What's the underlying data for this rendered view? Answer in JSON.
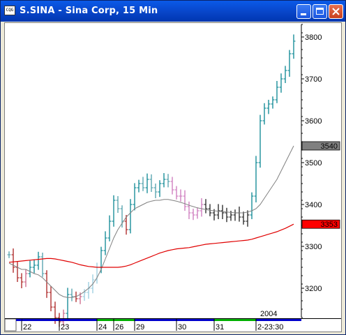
{
  "window": {
    "title": "S.SINA - Sina Corp, 15 Min",
    "icon": "chart-app-icon",
    "icon_text": "CQG",
    "buttons": [
      "minimize-icon",
      "maximize-icon",
      "close-icon"
    ]
  },
  "chart_data": {
    "type": "bar",
    "symbol": "S.SINA",
    "interval": "15 Min",
    "y_ticks": [
      3200,
      3300,
      3400,
      3500,
      3600,
      3700,
      3800
    ],
    "ylim": [
      3130,
      3830
    ],
    "price_markers": [
      {
        "label": "3540",
        "value": 3540,
        "color": "#808080"
      },
      {
        "label": "3353",
        "value": 3353,
        "color": "#ff0000"
      }
    ],
    "x_labels": [
      "22",
      "23",
      "24",
      "26",
      "29",
      "30",
      "31",
      "2-23:30"
    ],
    "x_label_idx": [
      3,
      12,
      21,
      25,
      30,
      40,
      49,
      59
    ],
    "year_label": "2004",
    "timebar_colors": [
      "#0000cc",
      "#0000cc",
      "#00b000",
      "#00b000",
      "#0000cc",
      "#0000cc",
      "#00b000",
      "#0000cc"
    ],
    "closes": [
      3280,
      3250,
      3225,
      3215,
      3235,
      3250,
      3255,
      3275,
      3235,
      3190,
      3155,
      3130,
      3120,
      3140,
      3185,
      3180,
      3175,
      3180,
      3190,
      3200,
      3220,
      3250,
      3290,
      3320,
      3360,
      3410,
      3390,
      3360,
      3340,
      3400,
      3440,
      3450,
      3440,
      3460,
      3440,
      3430,
      3450,
      3460,
      3455,
      3435,
      3420,
      3420,
      3395,
      3380,
      3375,
      3385,
      3400,
      3390,
      3380,
      3375,
      3385,
      3380,
      3370,
      3375,
      3380,
      3370,
      3360,
      3375,
      3420,
      3500,
      3600,
      3630,
      3640,
      3650,
      3680,
      3700,
      3720,
      3760,
      3790
    ],
    "ma_fast": [
      3260,
      3255,
      3250,
      3245,
      3245,
      3240,
      3235,
      3232,
      3225,
      3215,
      3205,
      3195,
      3185,
      3180,
      3178,
      3178,
      3180,
      3185,
      3192,
      3200,
      3210,
      3225,
      3245,
      3270,
      3295,
      3320,
      3340,
      3355,
      3370,
      3380,
      3390,
      3395,
      3400,
      3405,
      3408,
      3410,
      3410,
      3412,
      3412,
      3410,
      3408,
      3405,
      3402,
      3398,
      3395,
      3392,
      3390,
      3388,
      3386,
      3385,
      3384,
      3383,
      3382,
      3381,
      3380,
      3380,
      3380,
      3382,
      3385,
      3390,
      3400,
      3415,
      3430,
      3445,
      3460,
      3480,
      3500,
      3520,
      3540
    ],
    "ma_slow": [
      3262,
      3263,
      3264,
      3265,
      3266,
      3267,
      3268,
      3269,
      3270,
      3271,
      3271,
      3270,
      3268,
      3266,
      3264,
      3262,
      3259,
      3256,
      3254,
      3252,
      3251,
      3250,
      3250,
      3250,
      3250,
      3250,
      3250,
      3251,
      3253,
      3256,
      3260,
      3264,
      3268,
      3272,
      3276,
      3280,
      3284,
      3287,
      3290,
      3292,
      3294,
      3295,
      3296,
      3297,
      3299,
      3301,
      3303,
      3305,
      3306,
      3307,
      3308,
      3309,
      3310,
      3311,
      3312,
      3313,
      3314,
      3315,
      3317,
      3320,
      3323,
      3326,
      3329,
      3332,
      3335,
      3339,
      3343,
      3348,
      3353
    ]
  }
}
